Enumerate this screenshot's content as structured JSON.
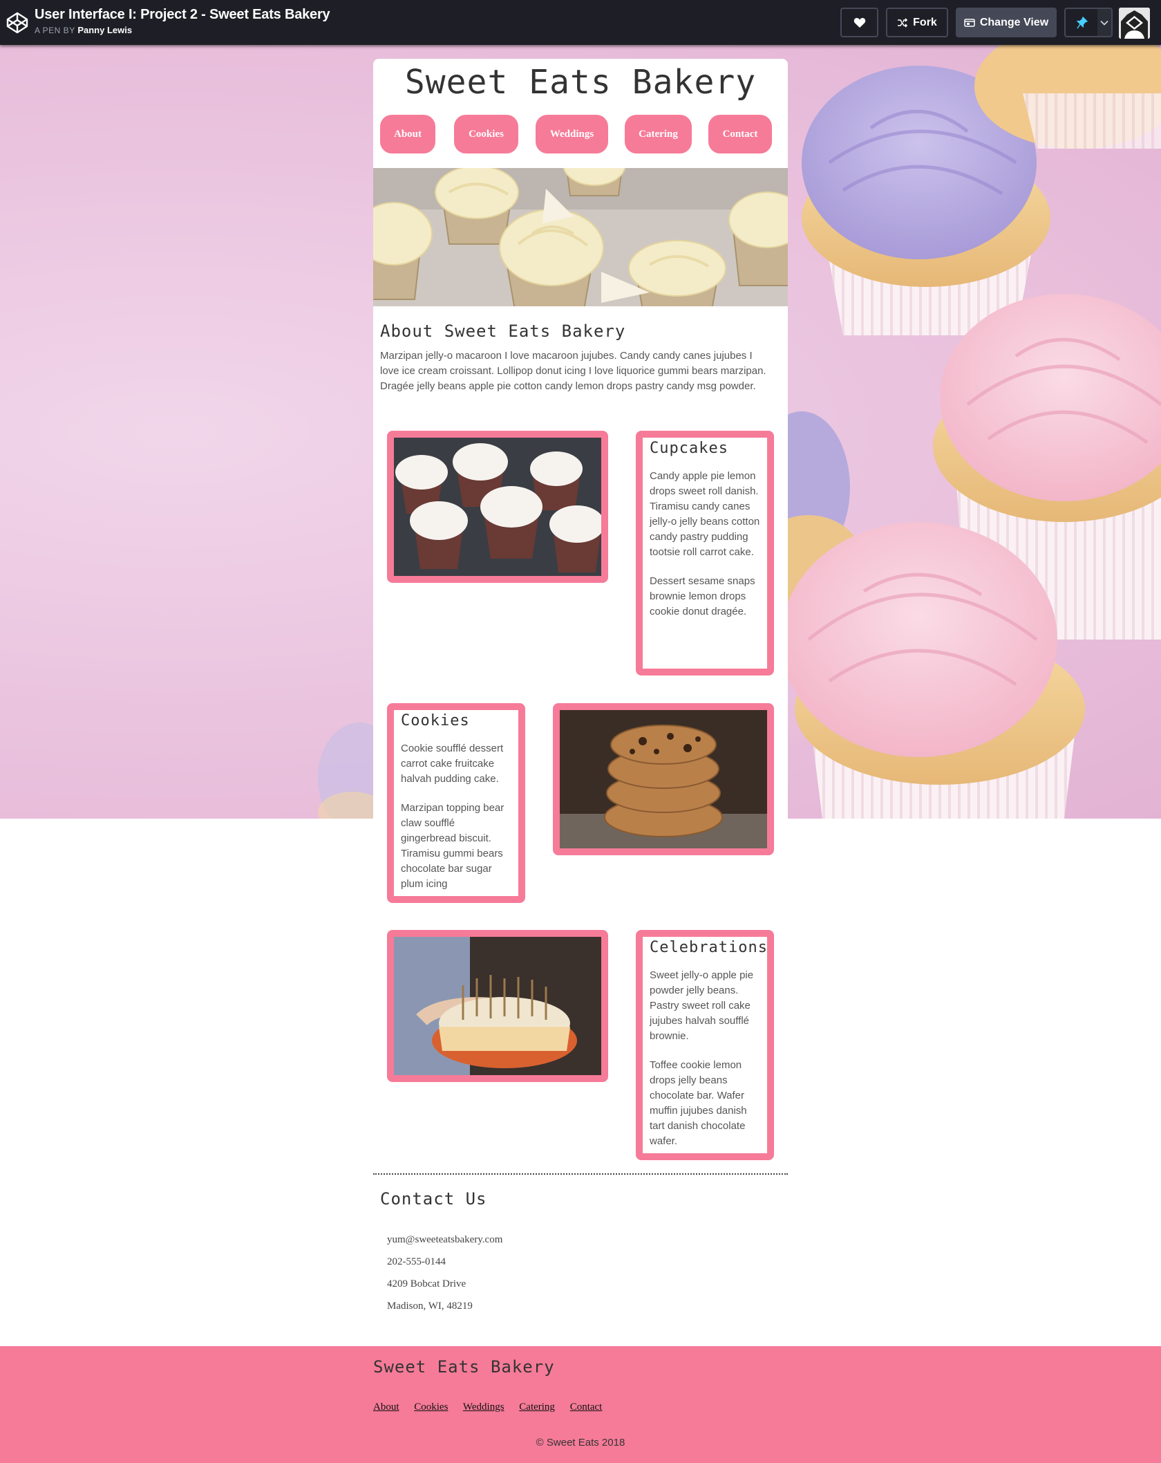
{
  "codepen": {
    "pen_title": "User Interface I: Project 2 - Sweet Eats Bakery",
    "by_label": "A PEN BY",
    "author": "Panny Lewis",
    "fork_label": "Fork",
    "change_view_label": "Change View"
  },
  "site": {
    "title": "Sweet Eats Bakery",
    "nav": [
      "About",
      "Cookies",
      "Weddings",
      "Catering",
      "Contact"
    ]
  },
  "about": {
    "heading": "About Sweet Eats Bakery",
    "text": "Marzipan jelly-o macaroon I love macaroon jujubes. Candy candy canes jujubes I love ice cream croissant. Lollipop donut icing I love liquorice gummi bears marzipan. Dragée jelly beans apple pie cotton candy lemon drops pastry candy msg powder."
  },
  "cards": {
    "cupcakes": {
      "heading": "Cupcakes",
      "p1": "Candy apple pie lemon drops sweet roll danish. Tiramisu candy canes jelly-o jelly beans cotton candy pastry pudding tootsie roll carrot cake.",
      "p2": "Dessert sesame snaps brownie lemon drops cookie donut dragée."
    },
    "cookies": {
      "heading": "Cookies",
      "p1": "Cookie soufflé dessert carrot cake fruitcake halvah pudding cake.",
      "p2": "Marzipan topping bear claw soufflé gingerbread biscuit. Tiramisu gummi bears chocolate bar sugar plum icing"
    },
    "celebrations": {
      "heading": "Celebrations",
      "p1": "Sweet jelly-o apple pie powder jelly beans. Pastry sweet roll cake jujubes halvah soufflé brownie.",
      "p2": "Toffee cookie lemon drops jelly beans chocolate bar. Wafer muffin jujubes danish tart danish chocolate wafer."
    }
  },
  "contact": {
    "heading": "Contact Us",
    "email": "yum@sweeteatsbakery.com",
    "phone": "202-555-0144",
    "street": "4209 Bobcat Drive",
    "city": "Madison, WI, 48219"
  },
  "footer": {
    "title": "Sweet Eats Bakery",
    "nav": [
      "About",
      "Cookies",
      "Weddings",
      "Catering",
      "Contact"
    ],
    "copyright": "© Sweet Eats 2018"
  },
  "colors": {
    "accent_pink": "#f67b98",
    "topbar": "#1e1f26",
    "hero_pink": "#e9c1dd"
  }
}
